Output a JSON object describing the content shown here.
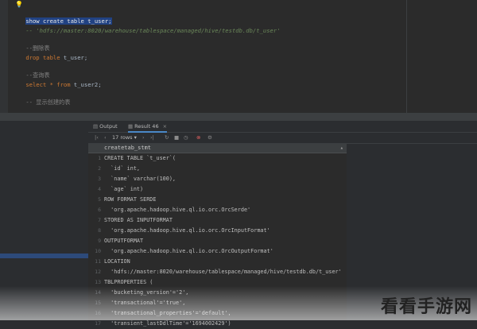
{
  "editor": {
    "lines": [
      {
        "kind": "selected",
        "text": "show create table t_user;"
      },
      {
        "kind": "path",
        "text": "-- 'hdfs://master:8020/warehouse/tablespace/managed/hive/testdb.db/t_user'"
      },
      {
        "kind": "comment",
        "text": "--删除表"
      },
      {
        "kind": "code",
        "kw": "drop table",
        "rest": " t_user;"
      },
      {
        "kind": "comment",
        "text": "--查询表"
      },
      {
        "kind": "code",
        "kw": "select * from",
        "rest": " t_user2;"
      },
      {
        "kind": "comment",
        "text": "-- 显示创建的表"
      }
    ]
  },
  "panel_tabs": {
    "output": "Output",
    "result": "Result 46"
  },
  "toolbar": {
    "rows_label": "17 rows",
    "nav_prev": "‹",
    "nav_next": "›"
  },
  "grid": {
    "column_header": "createtab_stmt",
    "rows": [
      "CREATE TABLE `t_user`(",
      "  `id` int,",
      "  `name` varchar(100),",
      "  `age` int)",
      "ROW FORMAT SERDE",
      "  'org.apache.hadoop.hive.ql.io.orc.OrcSerde'",
      "STORED AS INPUTFORMAT",
      "  'org.apache.hadoop.hive.ql.io.orc.OrcInputFormat'",
      "OUTPUTFORMAT",
      "  'org.apache.hadoop.hive.ql.io.orc.OrcOutputFormat'",
      "LOCATION",
      "  'hdfs://master:8020/warehouse/tablespace/managed/hive/testdb.db/t_user'",
      "TBLPROPERTIES (",
      "  'bucketing_version'='2',",
      "  'transactional'='true',",
      "  'transactional_properties'='default',",
      "  'transient_lastDdlTime'='1694002429')"
    ]
  },
  "watermark": "看看手游网"
}
